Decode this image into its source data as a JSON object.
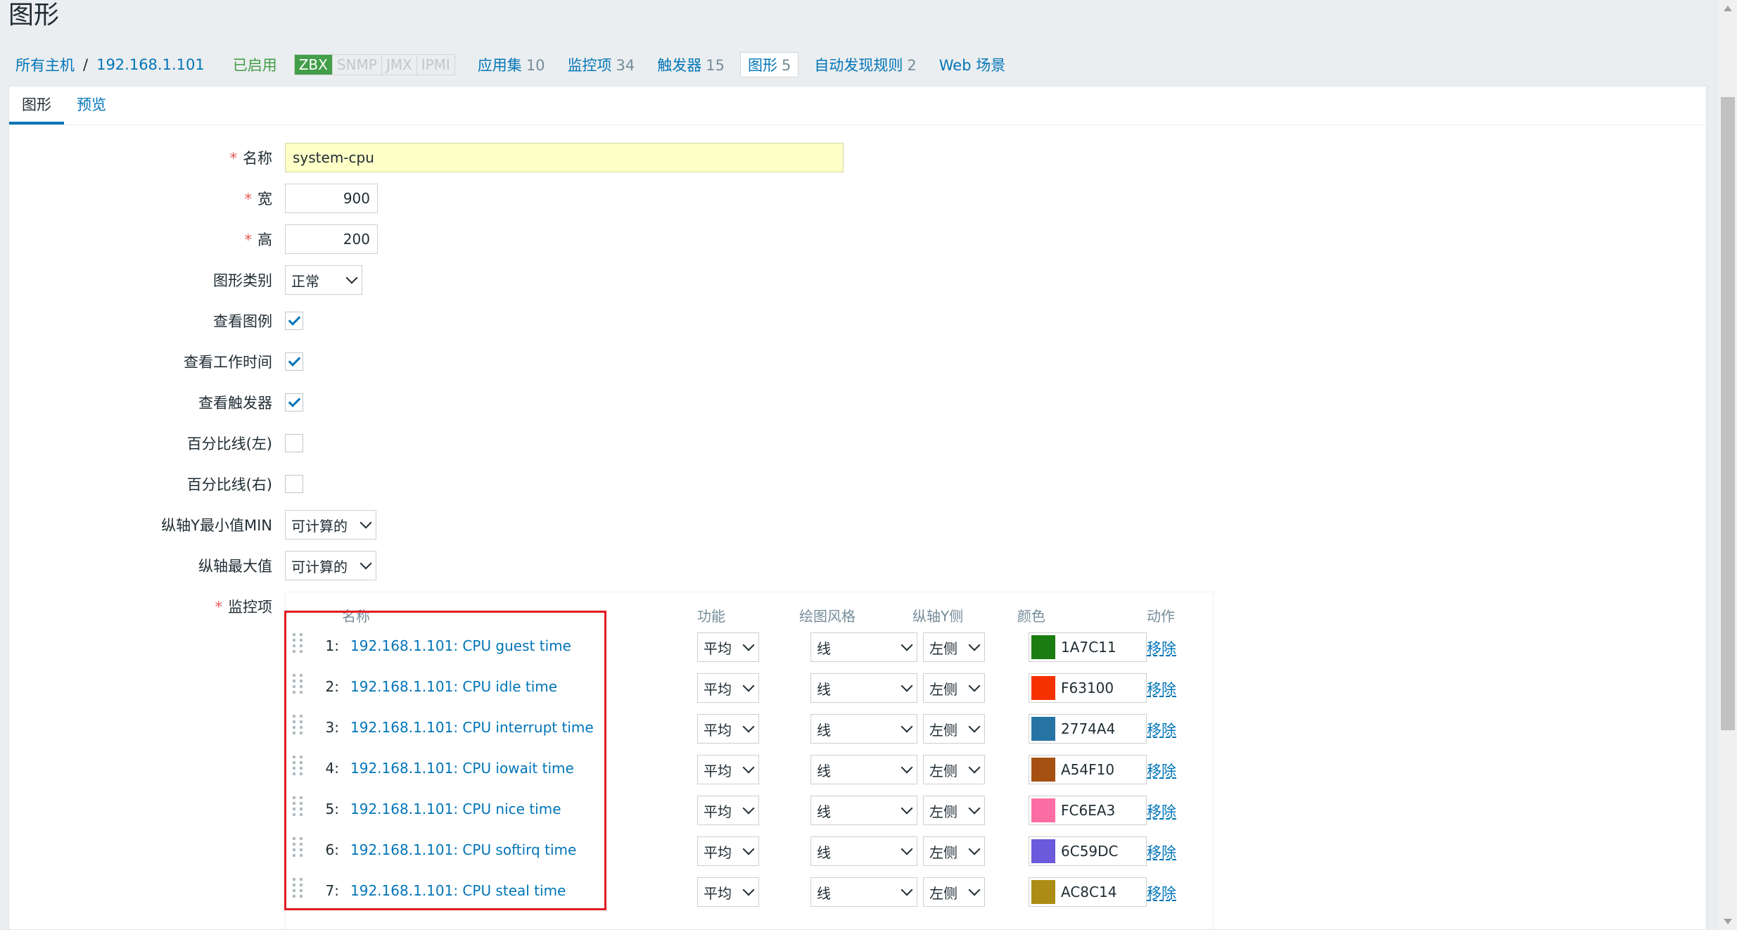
{
  "page": {
    "title": "图形"
  },
  "breadcrumb": {
    "all_hosts": "所有主机",
    "separator": "/",
    "host": "192.168.1.101",
    "status": "已启用",
    "badges": [
      "ZBX",
      "SNMP",
      "JMX",
      "IPMI"
    ],
    "links": [
      {
        "label": "应用集",
        "count": "10"
      },
      {
        "label": "监控项",
        "count": "34"
      },
      {
        "label": "触发器",
        "count": "15"
      },
      {
        "label": "图形",
        "count": "5"
      },
      {
        "label": "自动发现规则",
        "count": "2"
      },
      {
        "label": "Web 场景",
        "count": ""
      }
    ]
  },
  "tabs": [
    "图形",
    "预览"
  ],
  "form": {
    "required_mark": "*",
    "name_label": "名称",
    "name_value": "system-cpu",
    "width_label": "宽",
    "width_value": "900",
    "height_label": "高",
    "height_value": "200",
    "graph_type_label": "图形类别",
    "graph_type_value": "正常",
    "show_legend_label": "查看图例",
    "show_legend": true,
    "show_working_time_label": "查看工作时间",
    "show_working_time": true,
    "show_triggers_label": "查看触发器",
    "show_triggers": true,
    "percentile_left_label": "百分比线(左)",
    "percentile_left": false,
    "percentile_right_label": "百分比线(右)",
    "percentile_right": false,
    "ymin_label": "纵轴Y最小值MIN",
    "ymin_value": "可计算的",
    "ymax_label": "纵轴最大值",
    "ymax_value": "可计算的",
    "items_label": "监控项"
  },
  "items_table": {
    "headers": {
      "name": "名称",
      "function": "功能",
      "draw_style": "绘图风格",
      "y_axis": "纵轴Y侧",
      "color": "颜色",
      "action": "动作"
    },
    "rows": [
      {
        "num": "1:",
        "name": "192.168.1.101: CPU guest time",
        "function": "平均",
        "style": "线",
        "axis": "左侧",
        "color": "1A7C11",
        "action": "移除"
      },
      {
        "num": "2:",
        "name": "192.168.1.101: CPU idle time",
        "function": "平均",
        "style": "线",
        "axis": "左侧",
        "color": "F63100",
        "action": "移除"
      },
      {
        "num": "3:",
        "name": "192.168.1.101: CPU interrupt time",
        "function": "平均",
        "style": "线",
        "axis": "左侧",
        "color": "2774A4",
        "action": "移除"
      },
      {
        "num": "4:",
        "name": "192.168.1.101: CPU iowait time",
        "function": "平均",
        "style": "线",
        "axis": "左侧",
        "color": "A54F10",
        "action": "移除"
      },
      {
        "num": "5:",
        "name": "192.168.1.101: CPU nice time",
        "function": "平均",
        "style": "线",
        "axis": "左侧",
        "color": "FC6EA3",
        "action": "移除"
      },
      {
        "num": "6:",
        "name": "192.168.1.101: CPU softirq time",
        "function": "平均",
        "style": "线",
        "axis": "左侧",
        "color": "6C59DC",
        "action": "移除"
      },
      {
        "num": "7:",
        "name": "192.168.1.101: CPU steal time",
        "function": "平均",
        "style": "线",
        "axis": "左侧",
        "color": "AC8C14",
        "action": "移除"
      }
    ]
  }
}
